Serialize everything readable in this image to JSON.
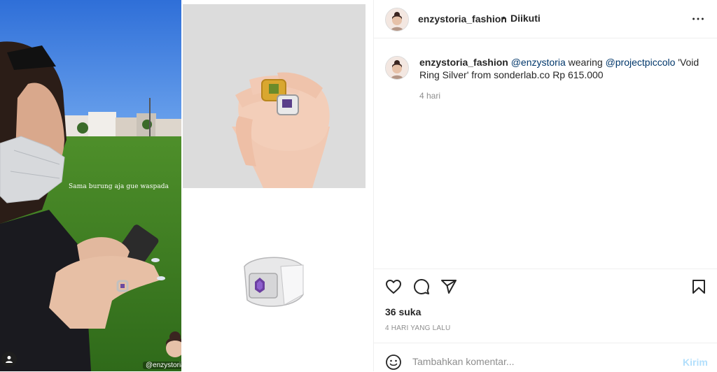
{
  "media": {
    "story_caption": "Sama burung aja gue waspada",
    "tag_label": "@enzystoria_fashion"
  },
  "post": {
    "username": "enzystoria_fashion",
    "separator": "•",
    "follow_status": "Diikuti",
    "caption": {
      "username": "enzystoria_fashion",
      "mention_1": "@enzystoria",
      "text_1": " wearing ",
      "mention_2": "@projectpiccolo",
      "text_2": " 'Void Ring Silver' from sonderlab.co Rp 615.000",
      "time": "4 hari"
    },
    "likes": "36 suka",
    "date": "4 HARI YANG LALU",
    "comment": {
      "placeholder": "Tambahkan komentar...",
      "post_label": "Kirim"
    }
  },
  "icons": [
    "more-icon",
    "heart-icon",
    "comment-icon",
    "share-icon",
    "bookmark-icon",
    "emoji-icon",
    "user-icon"
  ],
  "colors": {
    "text": "#262626",
    "secondary": "#8e8e8e",
    "mention": "#00376b",
    "post_button_disabled": "#b2dffc",
    "border": "#efefef"
  }
}
